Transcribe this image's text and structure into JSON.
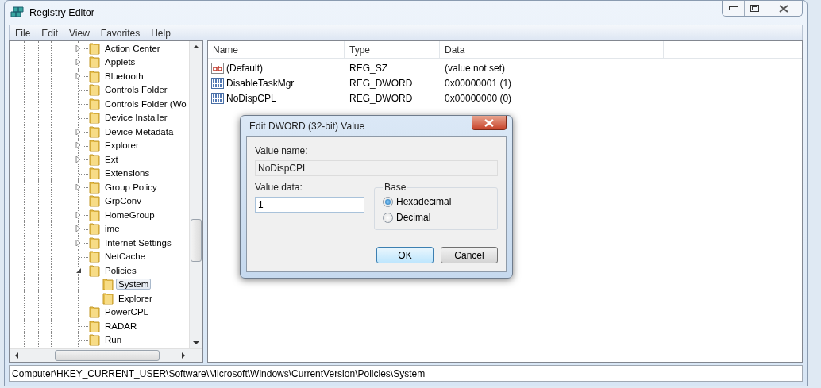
{
  "window": {
    "title": "Registry Editor"
  },
  "menu": [
    "File",
    "Edit",
    "View",
    "Favorites",
    "Help"
  ],
  "tree": [
    {
      "label": "Action Center",
      "expandable": true,
      "expanded": false,
      "selected": false
    },
    {
      "label": "Applets",
      "expandable": true,
      "expanded": false,
      "selected": false
    },
    {
      "label": "Bluetooth",
      "expandable": true,
      "expanded": false,
      "selected": false
    },
    {
      "label": "Controls Folder",
      "expandable": false,
      "selected": false
    },
    {
      "label": "Controls Folder (Wo",
      "expandable": false,
      "selected": false
    },
    {
      "label": "Device Installer",
      "expandable": false,
      "selected": false
    },
    {
      "label": "Device Metadata",
      "expandable": true,
      "expanded": false,
      "selected": false
    },
    {
      "label": "Explorer",
      "expandable": true,
      "expanded": false,
      "selected": false
    },
    {
      "label": "Ext",
      "expandable": true,
      "expanded": false,
      "selected": false
    },
    {
      "label": "Extensions",
      "expandable": false,
      "selected": false
    },
    {
      "label": "Group Policy",
      "expandable": true,
      "expanded": false,
      "selected": false
    },
    {
      "label": "GrpConv",
      "expandable": false,
      "selected": false
    },
    {
      "label": "HomeGroup",
      "expandable": true,
      "expanded": false,
      "selected": false
    },
    {
      "label": "ime",
      "expandable": true,
      "expanded": false,
      "selected": false
    },
    {
      "label": "Internet Settings",
      "expandable": true,
      "expanded": false,
      "selected": false
    },
    {
      "label": "NetCache",
      "expandable": false,
      "selected": false
    },
    {
      "label": "Policies",
      "expandable": true,
      "expanded": true,
      "selected": false,
      "children": [
        {
          "label": "System",
          "expandable": false,
          "selected": true
        },
        {
          "label": "Explorer",
          "expandable": false,
          "selected": false
        }
      ]
    },
    {
      "label": "PowerCPL",
      "expandable": false,
      "selected": false
    },
    {
      "label": "RADAR",
      "expandable": false,
      "selected": false
    },
    {
      "label": "Run",
      "expandable": false,
      "selected": false
    }
  ],
  "table": {
    "columns": [
      "Name",
      "Type",
      "Data"
    ],
    "rows": [
      {
        "kind": "string",
        "name": "(Default)",
        "type": "REG_SZ",
        "data": "(value not set)"
      },
      {
        "kind": "binary",
        "name": "DisableTaskMgr",
        "type": "REG_DWORD",
        "data": "0x00000001 (1)"
      },
      {
        "kind": "binary",
        "name": "NoDispCPL",
        "type": "REG_DWORD",
        "data": "0x00000000 (0)"
      }
    ]
  },
  "dialog": {
    "title": "Edit DWORD (32-bit) Value",
    "value_name_label": "Value name:",
    "value_name": "NoDispCPL",
    "value_data_label": "Value data:",
    "value_data": "1",
    "base_label": "Base",
    "bases": [
      {
        "label": "Hexadecimal",
        "selected": true
      },
      {
        "label": "Decimal",
        "selected": false
      }
    ],
    "buttons": [
      "OK",
      "Cancel"
    ]
  },
  "status_bar": "Computer\\HKEY_CURRENT_USER\\Software\\Microsoft\\Windows\\CurrentVersion\\Policies\\System"
}
